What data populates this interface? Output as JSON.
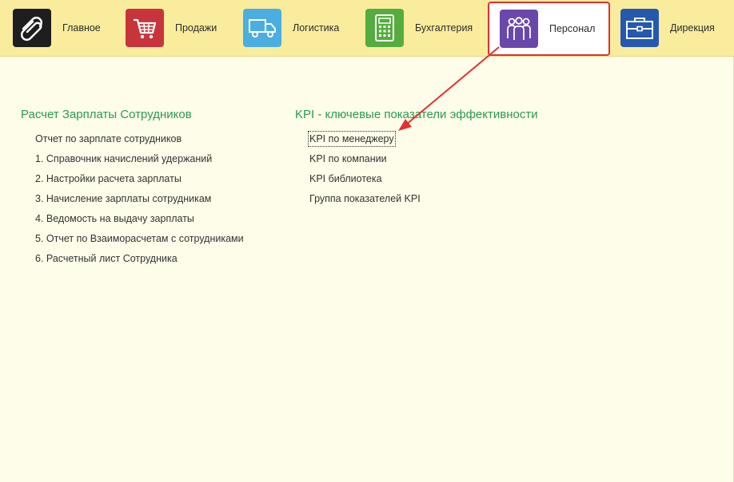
{
  "sections": [
    {
      "id": "main",
      "label": "Главное",
      "icon": "paperclip-icon",
      "color": "#1e1e1e"
    },
    {
      "id": "sales",
      "label": "Продажи",
      "icon": "shopping-cart-icon",
      "color": "#c8343c"
    },
    {
      "id": "logistics",
      "label": "Логистика",
      "icon": "truck-icon",
      "color": "#4aaee0"
    },
    {
      "id": "accounting",
      "label": "Бухгалтерия",
      "icon": "calculator-icon",
      "color": "#54ad3e"
    },
    {
      "id": "personnel",
      "label": "Персонал",
      "icon": "people-icon",
      "color": "#6a48ab"
    },
    {
      "id": "direction",
      "label": "Дирекция",
      "icon": "briefcase-icon",
      "color": "#2459ad"
    }
  ],
  "active_section": "Персонал",
  "left_column": {
    "title": "Расчет Зарплаты Сотрудников",
    "items": [
      "Отчет по зарплате сотрудников",
      "1. Справочник начислений удержаний",
      "2. Настройки расчета зарплаты",
      "3. Начисление зарплаты сотрудникам",
      "4. Ведомость на выдачу зарплаты",
      "5. Отчет по Взаиморасчетам с сотрудниками",
      "6. Расчетный лист Сотрудника"
    ]
  },
  "right_column": {
    "title": "KPI - ключевые показатели эффективности",
    "items": [
      "KPI по менеджеру",
      "KPI по компании",
      "KPI библиотека",
      "Группа показателей KPI"
    ]
  },
  "annotation_color": "#e0312f"
}
